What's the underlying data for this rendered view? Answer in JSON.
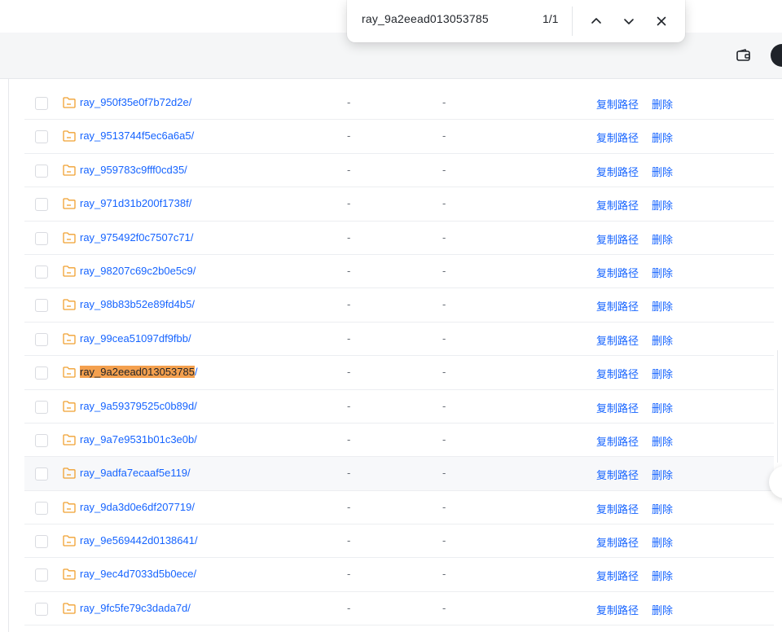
{
  "find_bar": {
    "query": "ray_9a2eead013053785",
    "match_count": "1/1",
    "prev_icon": "chevron-up-icon",
    "next_icon": "chevron-down-icon",
    "close_icon": "close-icon"
  },
  "toolbar": {
    "wallet_icon": "wallet-icon",
    "avatar_icon": "avatar"
  },
  "colors": {
    "link": "#1664ff",
    "folder": "#f0a030",
    "highlight": "#f4a04e"
  },
  "rows": [
    {
      "name": "ray_950f35e0f7b72d2e/",
      "col1": "-",
      "col2": "-",
      "copy": "复制路径",
      "delete": "删除"
    },
    {
      "name": "ray_9513744f5ec6a6a5/",
      "col1": "-",
      "col2": "-",
      "copy": "复制路径",
      "delete": "删除"
    },
    {
      "name": "ray_959783c9fff0cd35/",
      "col1": "-",
      "col2": "-",
      "copy": "复制路径",
      "delete": "删除"
    },
    {
      "name": "ray_971d31b200f1738f/",
      "col1": "-",
      "col2": "-",
      "copy": "复制路径",
      "delete": "删除"
    },
    {
      "name": "ray_975492f0c7507c71/",
      "col1": "-",
      "col2": "-",
      "copy": "复制路径",
      "delete": "删除"
    },
    {
      "name": "ray_98207c69c2b0e5c9/",
      "col1": "-",
      "col2": "-",
      "copy": "复制路径",
      "delete": "删除"
    },
    {
      "name": "ray_98b83b52e89fd4b5/",
      "col1": "-",
      "col2": "-",
      "copy": "复制路径",
      "delete": "删除"
    },
    {
      "name": "ray_99cea51097df9fbb/",
      "col1": "-",
      "col2": "-",
      "copy": "复制路径",
      "delete": "删除"
    },
    {
      "name": "ray_9a2eead013053785/",
      "col1": "-",
      "col2": "-",
      "copy": "复制路径",
      "delete": "删除",
      "match": "ray_9a2eead013053785",
      "rest": "/"
    },
    {
      "name": "ray_9a59379525c0b89d/",
      "col1": "-",
      "col2": "-",
      "copy": "复制路径",
      "delete": "删除"
    },
    {
      "name": "ray_9a7e9531b01c3e0b/",
      "col1": "-",
      "col2": "-",
      "copy": "复制路径",
      "delete": "删除"
    },
    {
      "name": "ray_9adfa7ecaaf5e119/",
      "col1": "-",
      "col2": "-",
      "copy": "复制路径",
      "delete": "删除",
      "hover": true
    },
    {
      "name": "ray_9da3d0e6df207719/",
      "col1": "-",
      "col2": "-",
      "copy": "复制路径",
      "delete": "删除"
    },
    {
      "name": "ray_9e569442d0138641/",
      "col1": "-",
      "col2": "-",
      "copy": "复制路径",
      "delete": "删除"
    },
    {
      "name": "ray_9ec4d7033d5b0ece/",
      "col1": "-",
      "col2": "-",
      "copy": "复制路径",
      "delete": "删除"
    },
    {
      "name": "ray_9fc5fe79c3dada7d/",
      "col1": "-",
      "col2": "-",
      "copy": "复制路径",
      "delete": "删除"
    }
  ]
}
